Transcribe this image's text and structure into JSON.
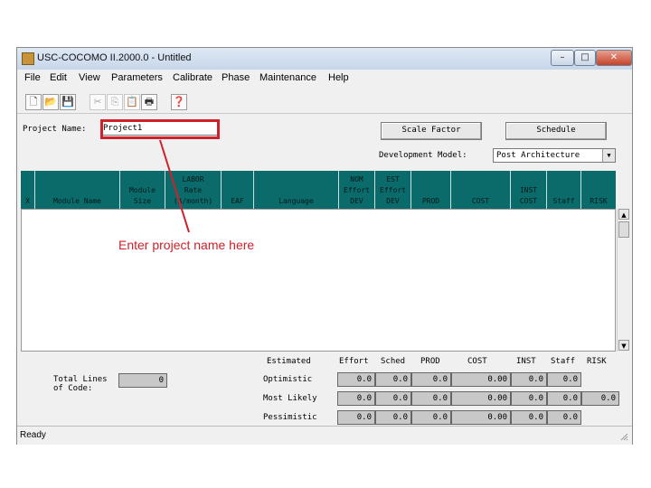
{
  "window": {
    "title": "USC-COCOMO II.2000.0 - Untitled"
  },
  "window_controls": {
    "minimize": "–",
    "maximize": "□",
    "close": "✕"
  },
  "menu": [
    "File",
    "Edit",
    "View",
    "Parameters",
    "Calibrate",
    "Phase",
    "Maintenance",
    "Help"
  ],
  "toolbar": {
    "new": "🗋",
    "open": "📂",
    "save": "💾",
    "cut": "✂",
    "copy": "⎘",
    "paste": "📋",
    "print": "🖶",
    "help": "❓"
  },
  "project": {
    "label": "Project Name:",
    "value": "Project1"
  },
  "buttons": {
    "scale_factor": "Scale Factor",
    "schedule": "Schedule"
  },
  "dev_model": {
    "label": "Development Model:",
    "value": "Post Architecture"
  },
  "columns": [
    {
      "key": "x",
      "lines": [
        "X"
      ]
    },
    {
      "key": "module_name",
      "lines": [
        "Module Name"
      ]
    },
    {
      "key": "module_size",
      "lines": [
        "Module",
        "Size"
      ]
    },
    {
      "key": "labor_rate",
      "lines": [
        "LABOR",
        "Rate",
        "($/month)"
      ]
    },
    {
      "key": "eaf",
      "lines": [
        "EAF"
      ]
    },
    {
      "key": "language",
      "lines": [
        "Language"
      ]
    },
    {
      "key": "nom_effort",
      "lines": [
        "NOM",
        "Effort",
        "DEV"
      ]
    },
    {
      "key": "est_effort",
      "lines": [
        "EST",
        "Effort",
        "DEV"
      ]
    },
    {
      "key": "prod",
      "lines": [
        "PROD"
      ]
    },
    {
      "key": "cost",
      "lines": [
        "COST"
      ]
    },
    {
      "key": "inst_cost",
      "lines": [
        "INST",
        "COST"
      ]
    },
    {
      "key": "staff",
      "lines": [
        "Staff"
      ]
    },
    {
      "key": "risk",
      "lines": [
        "RISK"
      ]
    }
  ],
  "annotation": "Enter project name here",
  "summary": {
    "total_lines_label_1": "Total Lines",
    "total_lines_label_2": "of Code:",
    "total_lines_value": "0",
    "headers": [
      "Estimated",
      "Effort",
      "Sched",
      "PROD",
      "COST",
      "INST",
      "Staff",
      "RISK"
    ],
    "rows": [
      {
        "label": "Optimistic",
        "values": [
          "0.0",
          "0.0",
          "0.0",
          "0.00",
          "0.0",
          "0.0"
        ]
      },
      {
        "label": "Most Likely",
        "values": [
          "0.0",
          "0.0",
          "0.0",
          "0.00",
          "0.0",
          "0.0",
          "0.0"
        ]
      },
      {
        "label": "Pessimistic",
        "values": [
          "0.0",
          "0.0",
          "0.0",
          "0.00",
          "0.0",
          "0.0"
        ]
      }
    ]
  },
  "status": "Ready"
}
